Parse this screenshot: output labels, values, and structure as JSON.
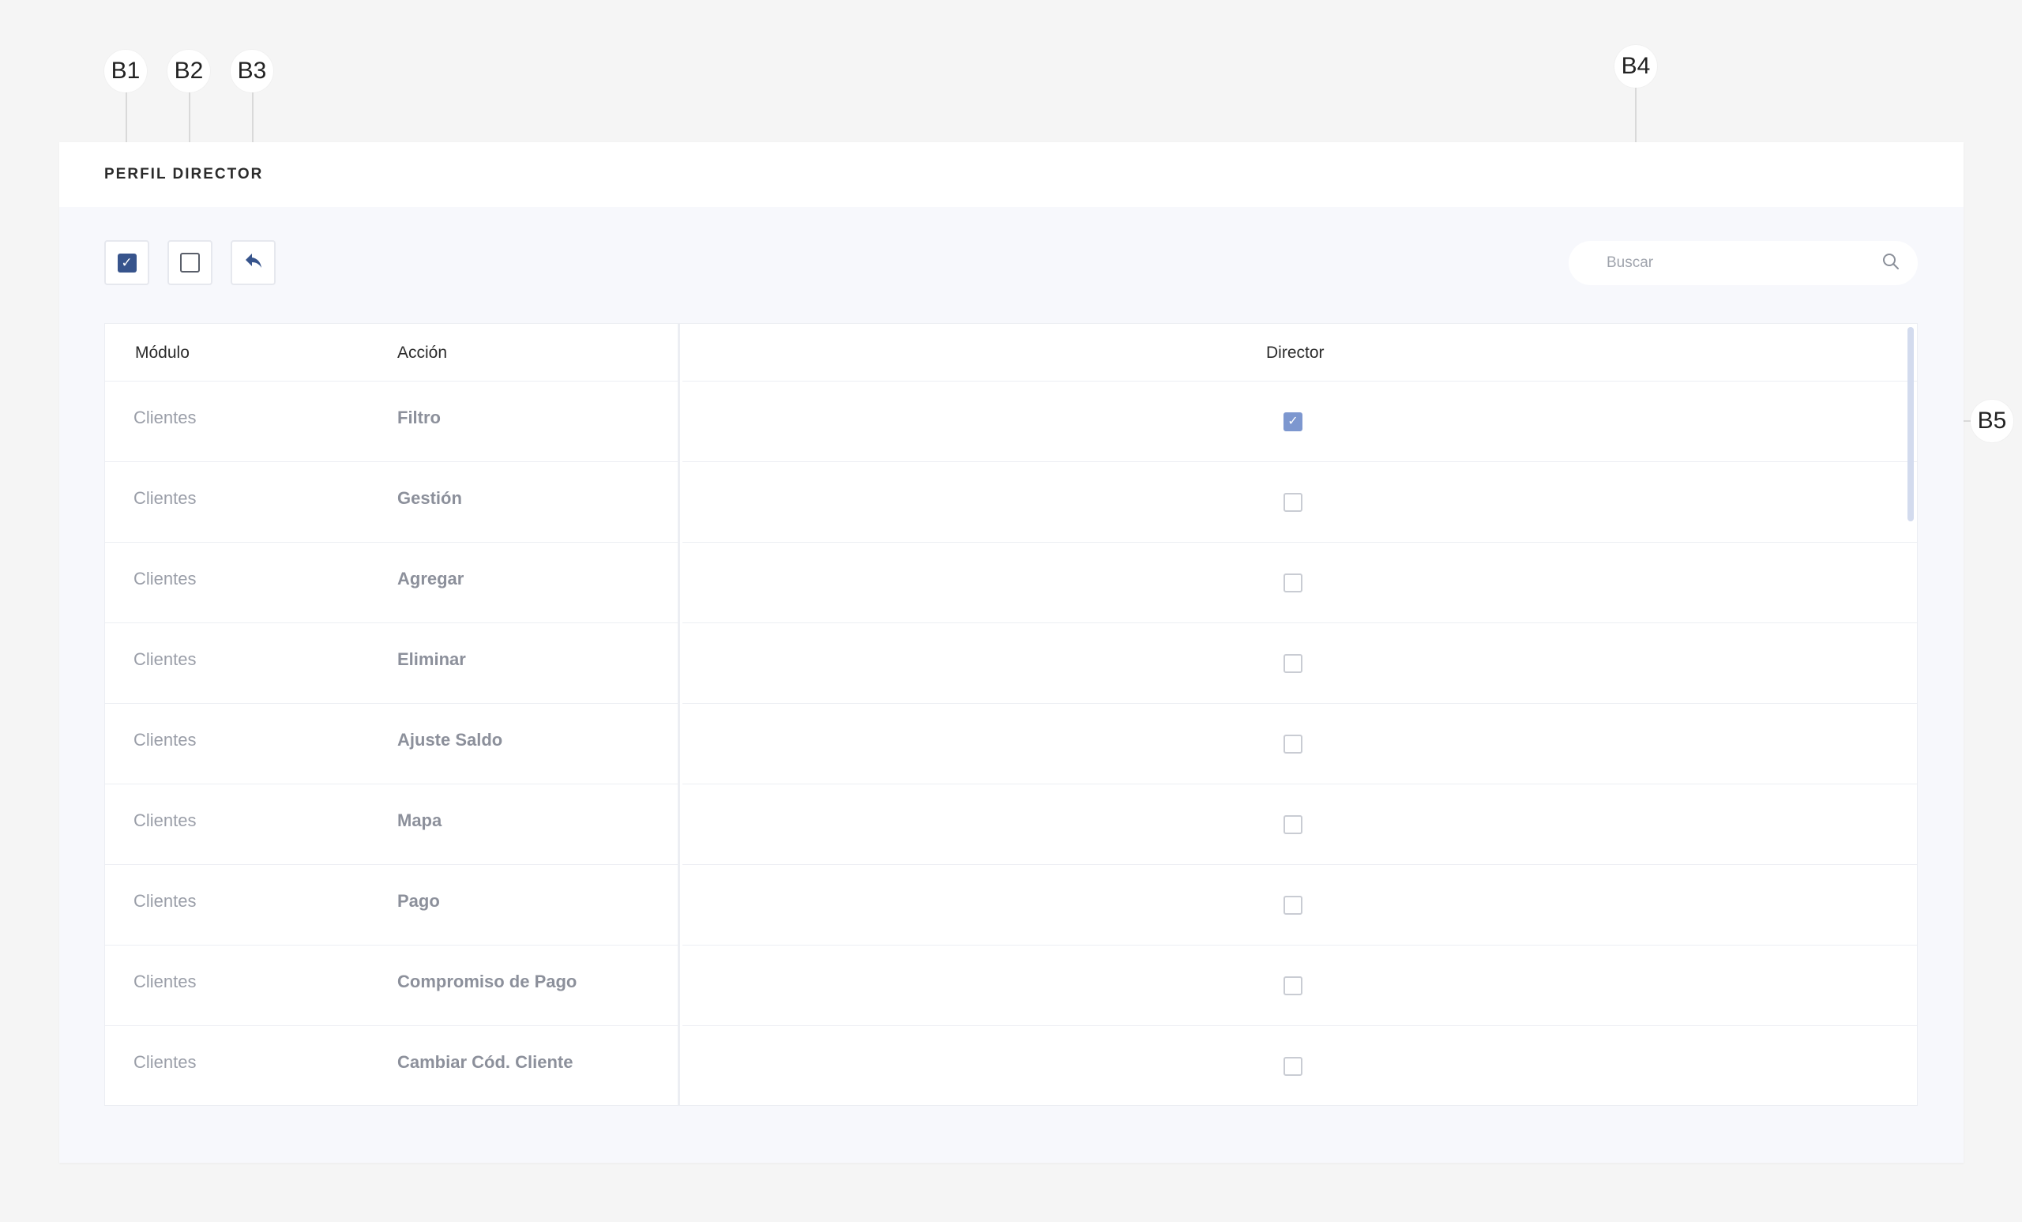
{
  "callouts": {
    "b1": "B1",
    "b2": "B2",
    "b3": "B3",
    "b4": "B4",
    "b5": "B5"
  },
  "card": {
    "title": "PERFIL DIRECTOR"
  },
  "toolbar": {
    "select_all_icon": "checkbox-checked-icon",
    "deselect_all_icon": "checkbox-empty-icon",
    "back_icon": "reply-arrow-icon"
  },
  "search": {
    "placeholder": "Buscar",
    "value": "",
    "icon": "search-icon"
  },
  "table": {
    "headers": {
      "module": "Módulo",
      "action": "Acción",
      "role": "Director"
    },
    "rows": [
      {
        "module": "Clientes",
        "action": "Filtro",
        "checked": true
      },
      {
        "module": "Clientes",
        "action": "Gestión",
        "checked": false
      },
      {
        "module": "Clientes",
        "action": "Agregar",
        "checked": false
      },
      {
        "module": "Clientes",
        "action": "Eliminar",
        "checked": false
      },
      {
        "module": "Clientes",
        "action": "Ajuste Saldo",
        "checked": false
      },
      {
        "module": "Clientes",
        "action": "Mapa",
        "checked": false
      },
      {
        "module": "Clientes",
        "action": "Pago",
        "checked": false
      },
      {
        "module": "Clientes",
        "action": "Compromiso de Pago",
        "checked": false
      },
      {
        "module": "Clientes",
        "action": "Cambiar Cód. Cliente",
        "checked": false
      }
    ]
  },
  "colors": {
    "accent": "#37548c",
    "checked": "#7d97cf",
    "background": "#f5f5f5"
  }
}
